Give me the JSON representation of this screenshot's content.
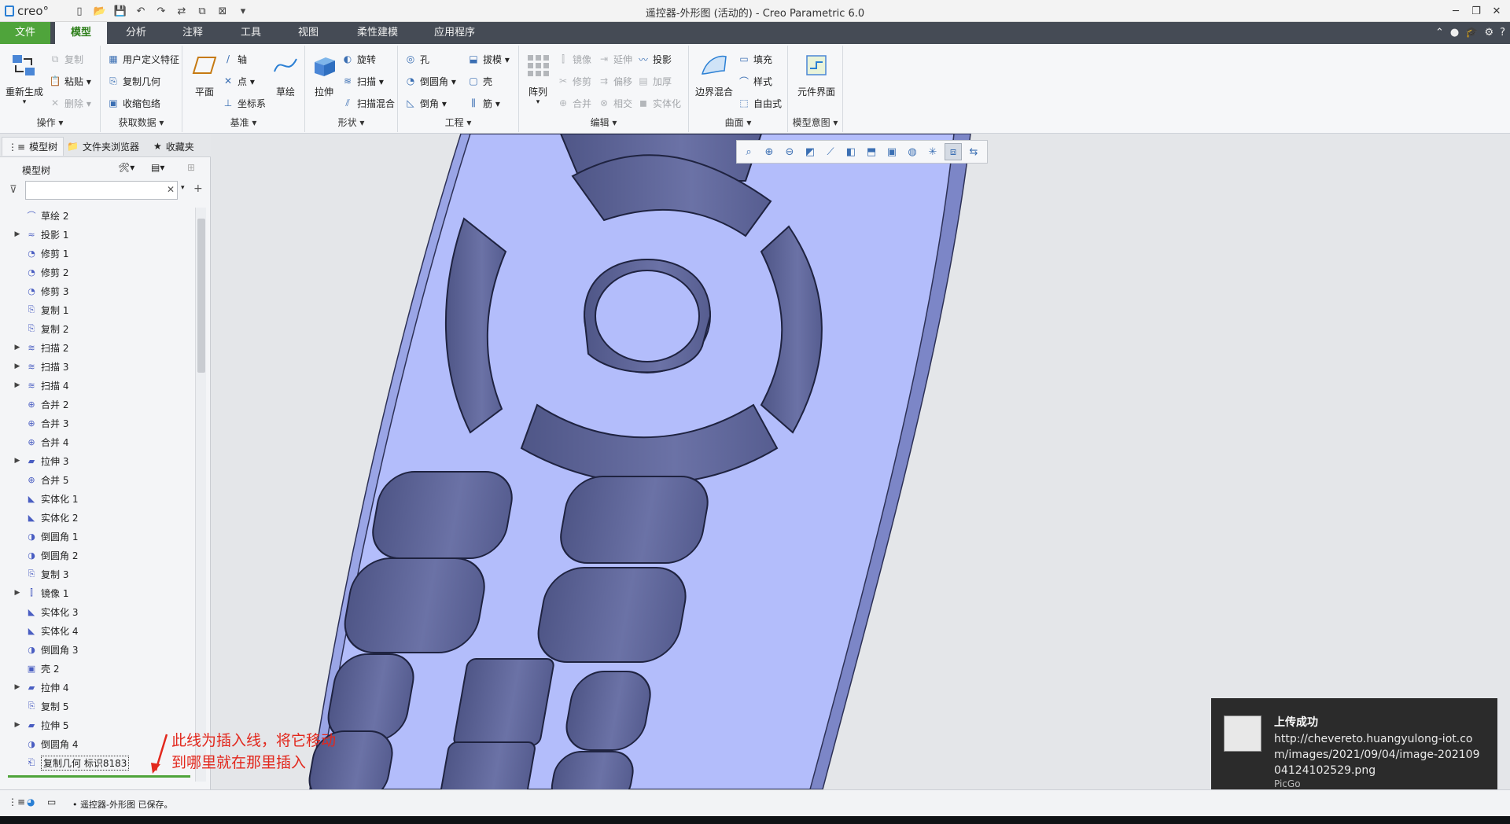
{
  "app": {
    "logo": "creo°",
    "window_title": "遥控器-外形图 (活动的) - Creo Parametric 6.0"
  },
  "tabs": [
    "文件",
    "模型",
    "分析",
    "注释",
    "工具",
    "视图",
    "柔性建模",
    "应用程序"
  ],
  "ribbon": {
    "groups": [
      {
        "label": "操作 ▾",
        "big": "重新生成",
        "items": [
          "复制",
          "粘贴 ▾",
          "删除 ▾"
        ]
      },
      {
        "label": "获取数据 ▾",
        "items": [
          "用户定义特征",
          "复制几何",
          "收缩包络"
        ]
      },
      {
        "label": "基准 ▾",
        "big": "平面",
        "big2": "草绘",
        "items": [
          "轴",
          "点 ▾",
          "坐标系"
        ]
      },
      {
        "label": "形状 ▾",
        "big": "拉伸",
        "items": [
          "旋转",
          "扫描 ▾",
          "扫描混合"
        ]
      },
      {
        "label": "工程 ▾",
        "items": [
          "孔",
          "倒圆角 ▾",
          "倒角 ▾",
          "拔模 ▾",
          "壳",
          "筋 ▾"
        ]
      },
      {
        "label": "编辑 ▾",
        "big": "阵列",
        "items": [
          "镜像",
          "修剪",
          "合并",
          "延伸",
          "偏移",
          "相交",
          "投影",
          "加厚",
          "实体化"
        ]
      },
      {
        "label": "曲面 ▾",
        "big": "边界混合",
        "items": [
          "填充",
          "样式",
          "自由式"
        ]
      },
      {
        "label": "模型意图 ▾",
        "big": "元件界面"
      }
    ]
  },
  "left_panel": {
    "tabs": [
      "模型树",
      "文件夹浏览器",
      "收藏夹"
    ],
    "header": "模型树",
    "tree": [
      {
        "label": "草绘 2",
        "exp": false,
        "icon": "sketch-icon"
      },
      {
        "label": "投影 1",
        "exp": true,
        "icon": "projection-icon"
      },
      {
        "label": "修剪 1",
        "exp": false,
        "icon": "trim-icon"
      },
      {
        "label": "修剪 2",
        "exp": false,
        "icon": "trim-icon"
      },
      {
        "label": "修剪 3",
        "exp": false,
        "icon": "trim-icon"
      },
      {
        "label": "复制 1",
        "exp": false,
        "icon": "copy-icon"
      },
      {
        "label": "复制 2",
        "exp": false,
        "icon": "copy-icon"
      },
      {
        "label": "扫描 2",
        "exp": true,
        "icon": "sweep-icon"
      },
      {
        "label": "扫描 3",
        "exp": true,
        "icon": "sweep-icon"
      },
      {
        "label": "扫描 4",
        "exp": true,
        "icon": "sweep-icon"
      },
      {
        "label": "合并 2",
        "exp": false,
        "icon": "merge-icon"
      },
      {
        "label": "合并 3",
        "exp": false,
        "icon": "merge-icon"
      },
      {
        "label": "合并 4",
        "exp": false,
        "icon": "merge-icon"
      },
      {
        "label": "拉伸 3",
        "exp": true,
        "icon": "extrude-icon"
      },
      {
        "label": "合并 5",
        "exp": false,
        "icon": "merge-icon"
      },
      {
        "label": "实体化 1",
        "exp": false,
        "icon": "solidify-icon"
      },
      {
        "label": "实体化 2",
        "exp": false,
        "icon": "solidify-icon"
      },
      {
        "label": "倒圆角 1",
        "exp": false,
        "icon": "round-icon"
      },
      {
        "label": "倒圆角 2",
        "exp": false,
        "icon": "round-icon"
      },
      {
        "label": "复制 3",
        "exp": false,
        "icon": "copy-icon"
      },
      {
        "label": "镜像 1",
        "exp": true,
        "icon": "mirror-icon"
      },
      {
        "label": "实体化 3",
        "exp": false,
        "icon": "solidify-icon"
      },
      {
        "label": "实体化 4",
        "exp": false,
        "icon": "solidify-icon"
      },
      {
        "label": "倒圆角 3",
        "exp": false,
        "icon": "round-icon"
      },
      {
        "label": "壳 2",
        "exp": false,
        "icon": "shell-icon"
      },
      {
        "label": "拉伸 4",
        "exp": true,
        "icon": "extrude-icon"
      },
      {
        "label": "复制 5",
        "exp": false,
        "icon": "copy-icon"
      },
      {
        "label": "拉伸 5",
        "exp": true,
        "icon": "extrude-icon"
      },
      {
        "label": "倒圆角 4",
        "exp": false,
        "icon": "round-icon"
      },
      {
        "label": "复制几何 标识8183",
        "exp": false,
        "icon": "copy-geometry-icon"
      }
    ]
  },
  "annotation": {
    "line1": "此线为插入线，将它移动",
    "line2": "到哪里就在那里插入"
  },
  "toast": {
    "title": "上传成功",
    "url": "http://chevereto.huangyulong-iot.com/images/2021/09/04/image-20210904124102529.png",
    "source": "PicGo"
  },
  "status": {
    "message": "• 遥控器-外形图 已保存。"
  },
  "colors": {
    "file_tab": "#4fa43b",
    "model_face": "#5d6494",
    "model_surface": "#b3bdfb",
    "annotation": "#e2281d",
    "insert_line": "#4fa43b"
  }
}
